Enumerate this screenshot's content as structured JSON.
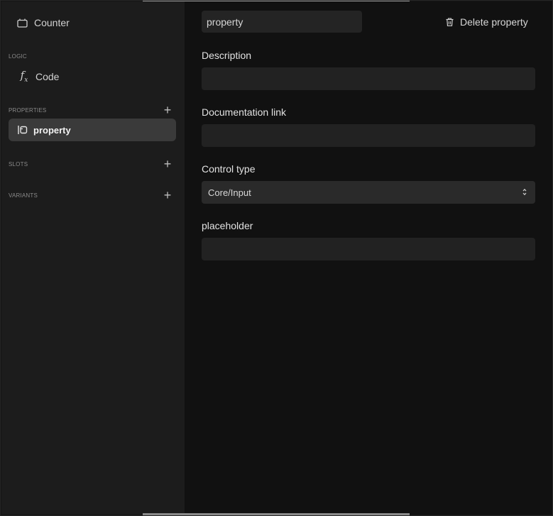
{
  "sidebar": {
    "component_name": "Counter",
    "sections": {
      "logic": "LOGIC",
      "properties": "PROPERTIES",
      "slots": "SLOTS",
      "variants": "VARIANTS"
    },
    "logic_item": "Code",
    "property_item": "property",
    "add_symbol": "+"
  },
  "main": {
    "property_name": "property",
    "delete_label": "Delete property",
    "description_label": "Description",
    "description_value": "",
    "doc_link_label": "Documentation link",
    "doc_link_value": "",
    "control_type_label": "Control type",
    "control_type_value": "Core/Input",
    "placeholder_label": "placeholder",
    "placeholder_value": ""
  },
  "icons": {
    "component": "component-icon",
    "function": "function-icon",
    "property": "property-icon",
    "trash": "trash-icon",
    "chevron": "chevron-updown-icon"
  }
}
